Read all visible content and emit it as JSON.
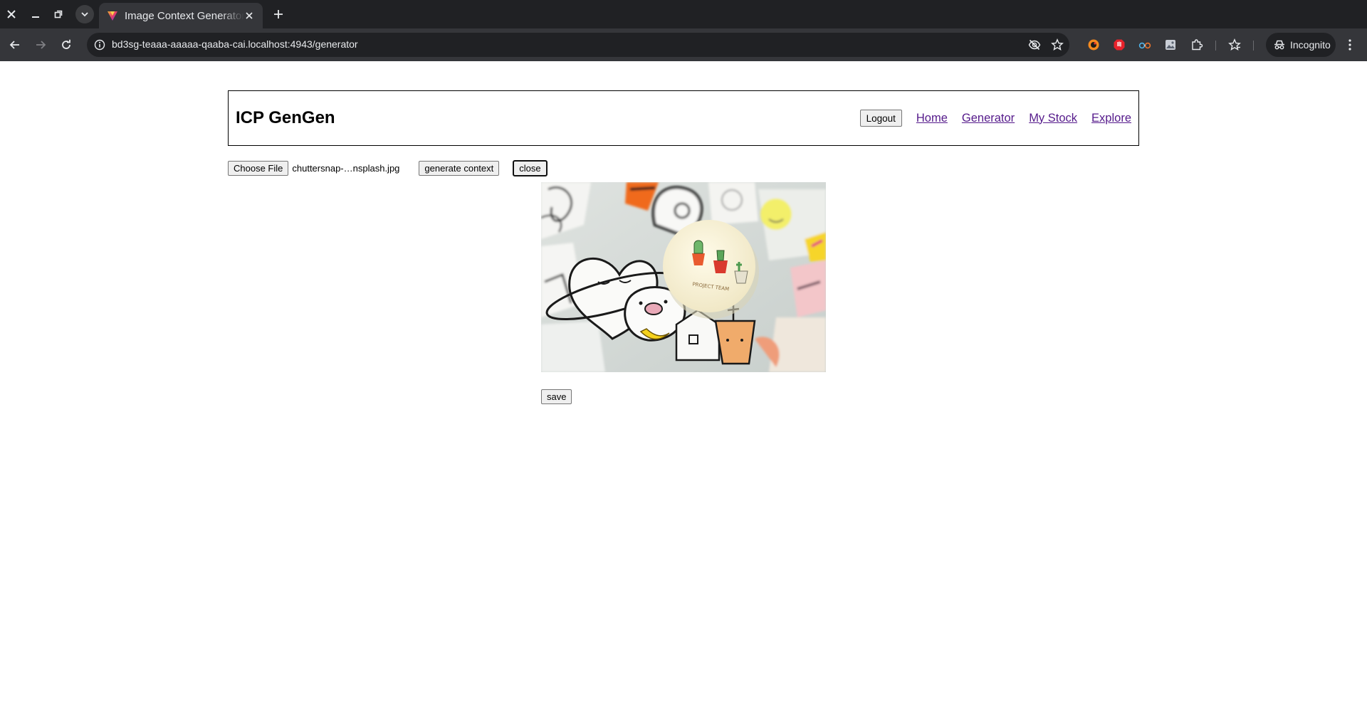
{
  "browser": {
    "tab_title": "Image Context Generator",
    "url": "bd3sg-teaaa-aaaaa-qaaba-cai.localhost:4943/generator",
    "incognito_label": "Incognito"
  },
  "header": {
    "title": "ICP GenGen",
    "logout_label": "Logout",
    "nav": {
      "home": "Home",
      "generator": "Generator",
      "my_stock": "My Stock",
      "explore": "Explore"
    }
  },
  "controls": {
    "choose_file_label": "Choose File",
    "file_name": "chuttersnap-…nsplash.jpg",
    "generate_label": "generate context",
    "close_label": "close"
  },
  "image": {
    "button_text": "PROJECT TEAM"
  },
  "save_label": "save",
  "colors": {
    "chrome_dark": "#202124",
    "chrome_toolbar": "#35363a",
    "link_visited": "#551a8b"
  }
}
